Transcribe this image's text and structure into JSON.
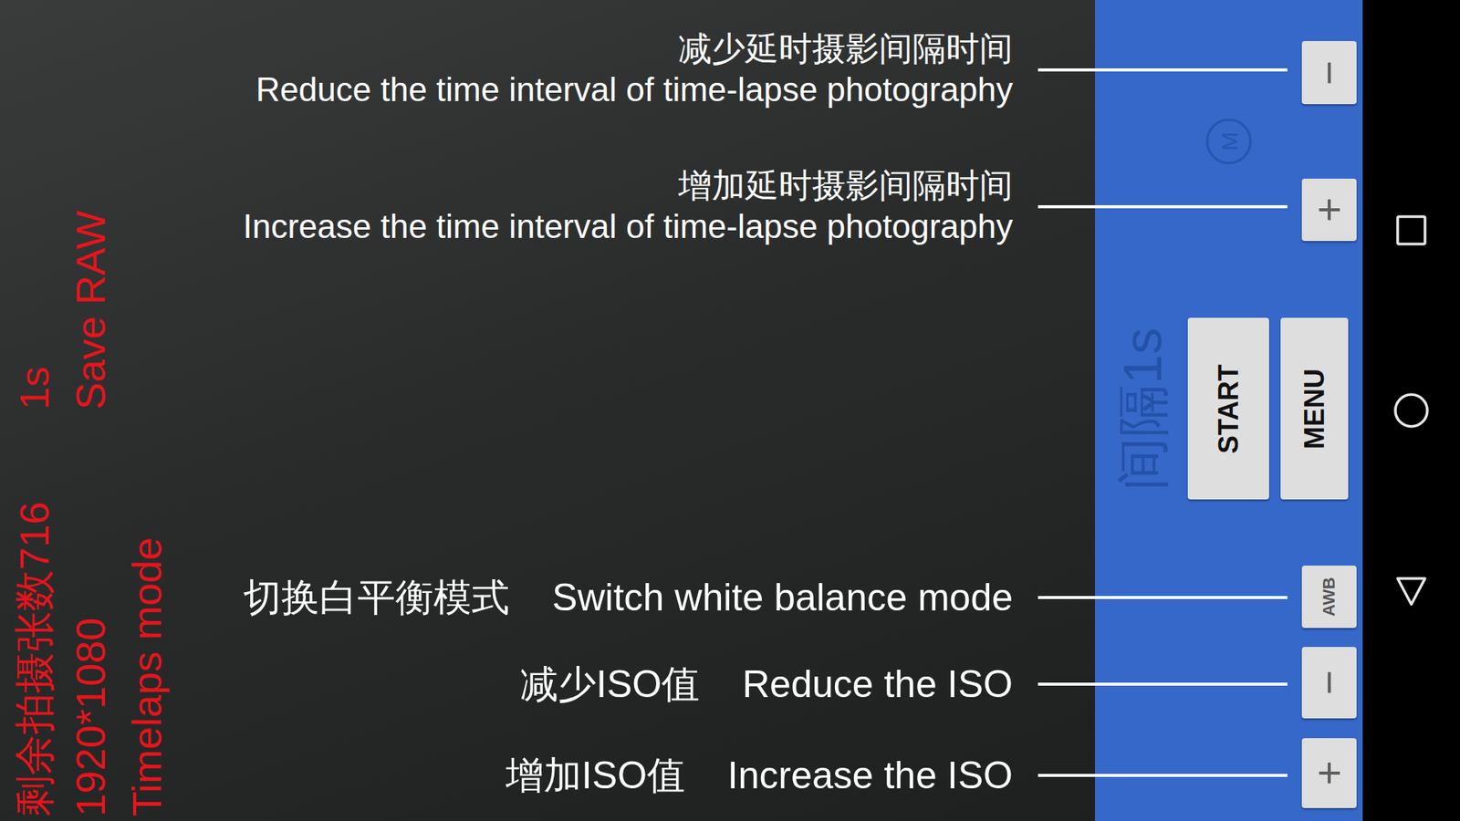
{
  "viewfinder": {
    "hud": {
      "remaining": "剩余拍摄张数716",
      "interval": "1s",
      "resolution": "1920*1080",
      "format": "Save RAW",
      "mode": "Timelaps mode"
    }
  },
  "panel": {
    "interval_minus": "−",
    "mode_badge": "M",
    "interval_plus": "+",
    "interval_display": "间隔1s",
    "start_button": "START",
    "menu_button": "MENU",
    "awb_button": "AWB",
    "iso_minus": "−",
    "iso_plus": "+"
  },
  "annotations": [
    {
      "zh": "减少延时摄影间隔时间",
      "en": "Reduce the time interval of time-lapse photography",
      "kind": "stacked"
    },
    {
      "zh": "增加延时摄影间隔时间",
      "en": "Increase the time interval of time-lapse photography",
      "kind": "stacked"
    },
    {
      "zh": "切换白平衡模式",
      "en": "Switch white balance mode",
      "kind": "inline"
    },
    {
      "zh": "减少ISO值",
      "en": "Reduce the ISO",
      "kind": "inline"
    },
    {
      "zh": "增加ISO值",
      "en": "Increase the ISO",
      "kind": "inline"
    }
  ]
}
